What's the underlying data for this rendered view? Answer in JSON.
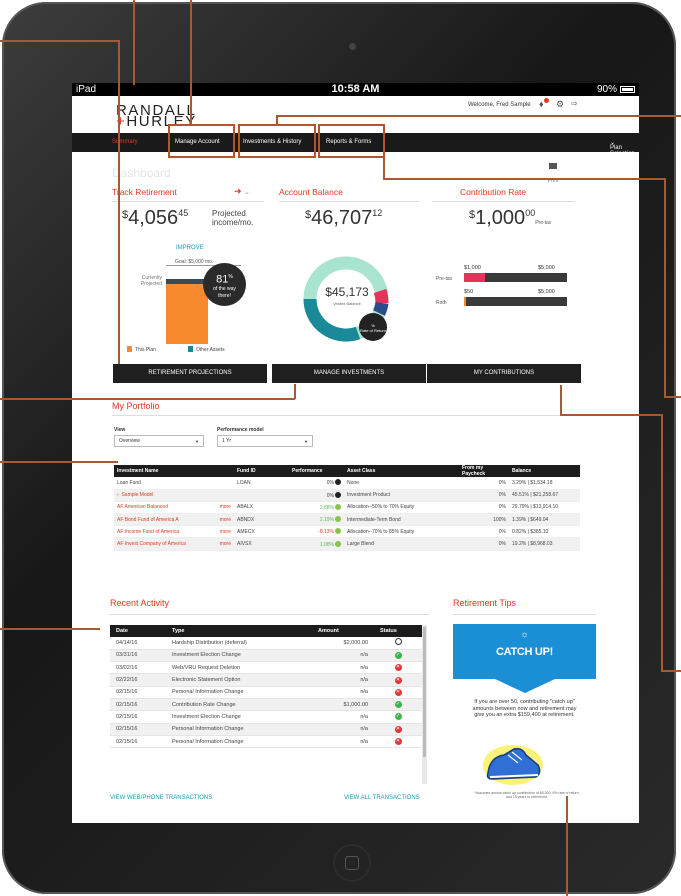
{
  "device": {
    "carrier": "iPad",
    "time": "10:58 AM",
    "battery": "90%"
  },
  "header": {
    "logo_line1": "RANDALL",
    "logo_line2": "HURLEY",
    "welcome": "Welcome, Fred Sample"
  },
  "nav": {
    "items": [
      "Summary",
      "Manage Account",
      "Investments & History",
      "Reports & Forms"
    ],
    "plan_selection": "Plan Selection"
  },
  "dashboard": {
    "title": "Dashboard",
    "print": "Print"
  },
  "track": {
    "title": "Track Retirement",
    "amount_currency": "$",
    "amount_whole": "4,056",
    "amount_cents": "45",
    "amount_label_1": "Projected",
    "amount_label_2": "income/mo.",
    "improve": "IMPROVE",
    "goal": "Goal: $5,000 mo.",
    "currently_1": "Currently",
    "currently_2": "Projected",
    "pct_value": "81",
    "pct_sign": "%",
    "pct_label_1": "of the way",
    "pct_label_2": "there!",
    "progress_fraction": 0.81,
    "legend_this": "This Plan",
    "legend_other": "Other Assets",
    "button": "RETIREMENT PROJECTIONS",
    "colors": {
      "this_plan": "#f7892f",
      "other_assets": "#1a8a99"
    }
  },
  "balance": {
    "title": "Account Balance",
    "amount_currency": "$",
    "amount_whole": "46,707",
    "amount_cents": "12",
    "vested": "$45,173",
    "vested_label": "Vested Balance",
    "ror_pct": "%",
    "ror_label": "Rate of Return",
    "button": "MANAGE INVESTMENTS"
  },
  "contribution": {
    "title": "Contribution Rate",
    "amount_currency": "$",
    "amount_whole": "1,000",
    "amount_cents": "00",
    "amount_sub": "Pre-tax",
    "pretax_label": "Pre-tax",
    "pretax_min": "$1,000",
    "pretax_max": "$5,000",
    "pretax_fill": 0.2,
    "roth_label": "Roth",
    "roth_min": "$50",
    "roth_max": "$5,000",
    "roth_fill": 0.01,
    "button": "MY CONTRIBUTIONS"
  },
  "portfolio": {
    "title": "My Portfolio",
    "view_label": "View",
    "view_value": "Overview",
    "perf_label": "Performance model",
    "perf_value": "1 Yr",
    "columns": [
      "Investment Name",
      "Fund ID",
      "Performance",
      "Asset Class",
      "From my Paycheck",
      "Balance"
    ],
    "rows": [
      {
        "name": "Loan Fund",
        "more": "",
        "fund": "LOAN",
        "perf": "0%",
        "asset": "None",
        "paycheck": "0%",
        "balance": "3.29% | $1,534.18"
      },
      {
        "name": "Sample Model",
        "more": "",
        "fund": "",
        "perf": "0%",
        "asset": "Investment Product",
        "paycheck": "0%",
        "balance": "45.51% | $21,258.67"
      },
      {
        "name": "AF American Balanced",
        "more": "more",
        "fund": "ABALX",
        "perf": "2.88%",
        "asset": "Allocation--50% to 70% Equity",
        "paycheck": "0%",
        "balance": "29.79% | $13,914.10"
      },
      {
        "name": "AF Bond Fund of America A",
        "more": "more",
        "fund": "ABNDX",
        "perf": "2.19%",
        "asset": "Intermediate-Term Bond",
        "paycheck": "100%",
        "balance": "1.39% | $649.04"
      },
      {
        "name": "AF Income Fund of America",
        "more": "more",
        "fund": "AMECX",
        "perf": "-8.13%",
        "asset": "Allocation--70% to 85% Equity",
        "paycheck": "0%",
        "balance": "0.82% | $385.10"
      },
      {
        "name": "AF Invest Company of America",
        "more": "more",
        "fund": "AIVSX",
        "perf": "1.08%",
        "asset": "Large Blend",
        "paycheck": "0%",
        "balance": "19.2% | $8,968.03"
      }
    ]
  },
  "activity": {
    "title": "Recent Activity",
    "columns": [
      "Date",
      "Type",
      "Amount",
      "Status"
    ],
    "rows": [
      {
        "date": "04/14/16",
        "type": "Hardship Distribution (deferral)",
        "amount": "$2,000.00",
        "status": "pending"
      },
      {
        "date": "03/31/16",
        "type": "Investment Election Change",
        "amount": "n/a",
        "status": "ok"
      },
      {
        "date": "03/02/16",
        "type": "Web/VRU Request Deletion",
        "amount": "n/a",
        "status": "no"
      },
      {
        "date": "02/22/16",
        "type": "Electronic Statement Option",
        "amount": "n/a",
        "status": "no"
      },
      {
        "date": "02/15/16",
        "type": "Personal Information Change",
        "amount": "n/a",
        "status": "no"
      },
      {
        "date": "02/15/16",
        "type": "Contribution Rate Change",
        "amount": "$1,000.00",
        "status": "ok"
      },
      {
        "date": "02/15/16",
        "type": "Investment Election Change",
        "amount": "n/a",
        "status": "ok"
      },
      {
        "date": "02/15/16",
        "type": "Personal Information Change",
        "amount": "n/a",
        "status": "no"
      },
      {
        "date": "02/15/16",
        "type": "Personal Information Change",
        "amount": "n/a",
        "status": "no"
      }
    ],
    "link_web": "VIEW WEB/PHONE TRANSACTIONS",
    "link_all": "VIEW ALL TRANSACTIONS"
  },
  "tips": {
    "title": "Retirement Tips",
    "heading": "CATCH UP!",
    "body": "If you are over 50, contributing \"catch up\" amounts between now and retirement may give you an extra $159,400 at retirement.",
    "footnote": "*Assumes annual catch up contribution of $6,000, 6% rate of return, and 15 years to retirement."
  },
  "colors": {
    "accent": "#e03a21",
    "link": "#1b9db8",
    "dark": "#1a1a1a",
    "callout": "#b5532a"
  }
}
